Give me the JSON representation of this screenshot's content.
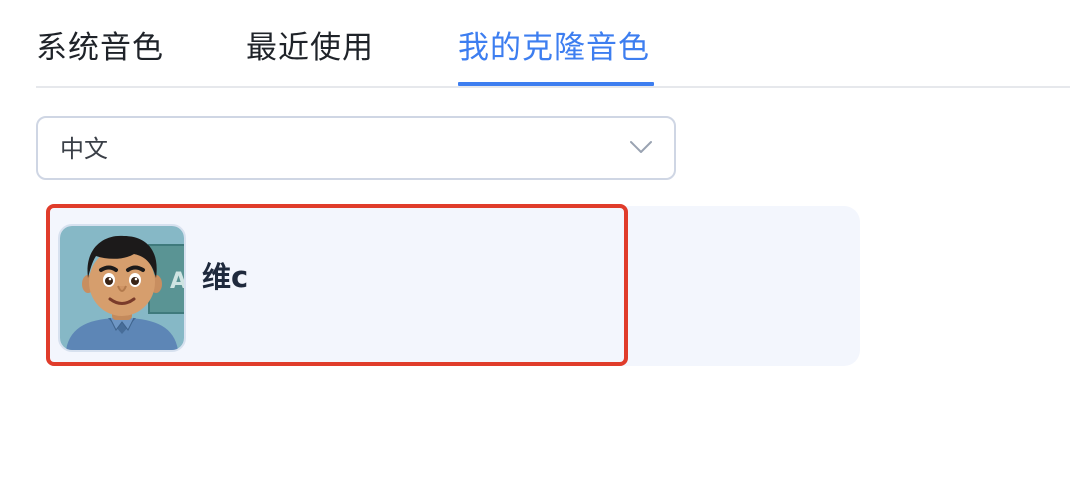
{
  "tabs": [
    {
      "label": "系统音色",
      "active": false
    },
    {
      "label": "最近使用",
      "active": false
    },
    {
      "label": "我的克隆音色",
      "active": true
    }
  ],
  "colors": {
    "accent": "#3d7ef0",
    "highlight_border": "#e03c2b",
    "card_background": "#f3f6fd"
  },
  "language_select": {
    "value": "中文",
    "icon": "chevron-down-icon"
  },
  "voices": [
    {
      "name": "维c",
      "avatar": "cartoon-man-avatar"
    }
  ]
}
